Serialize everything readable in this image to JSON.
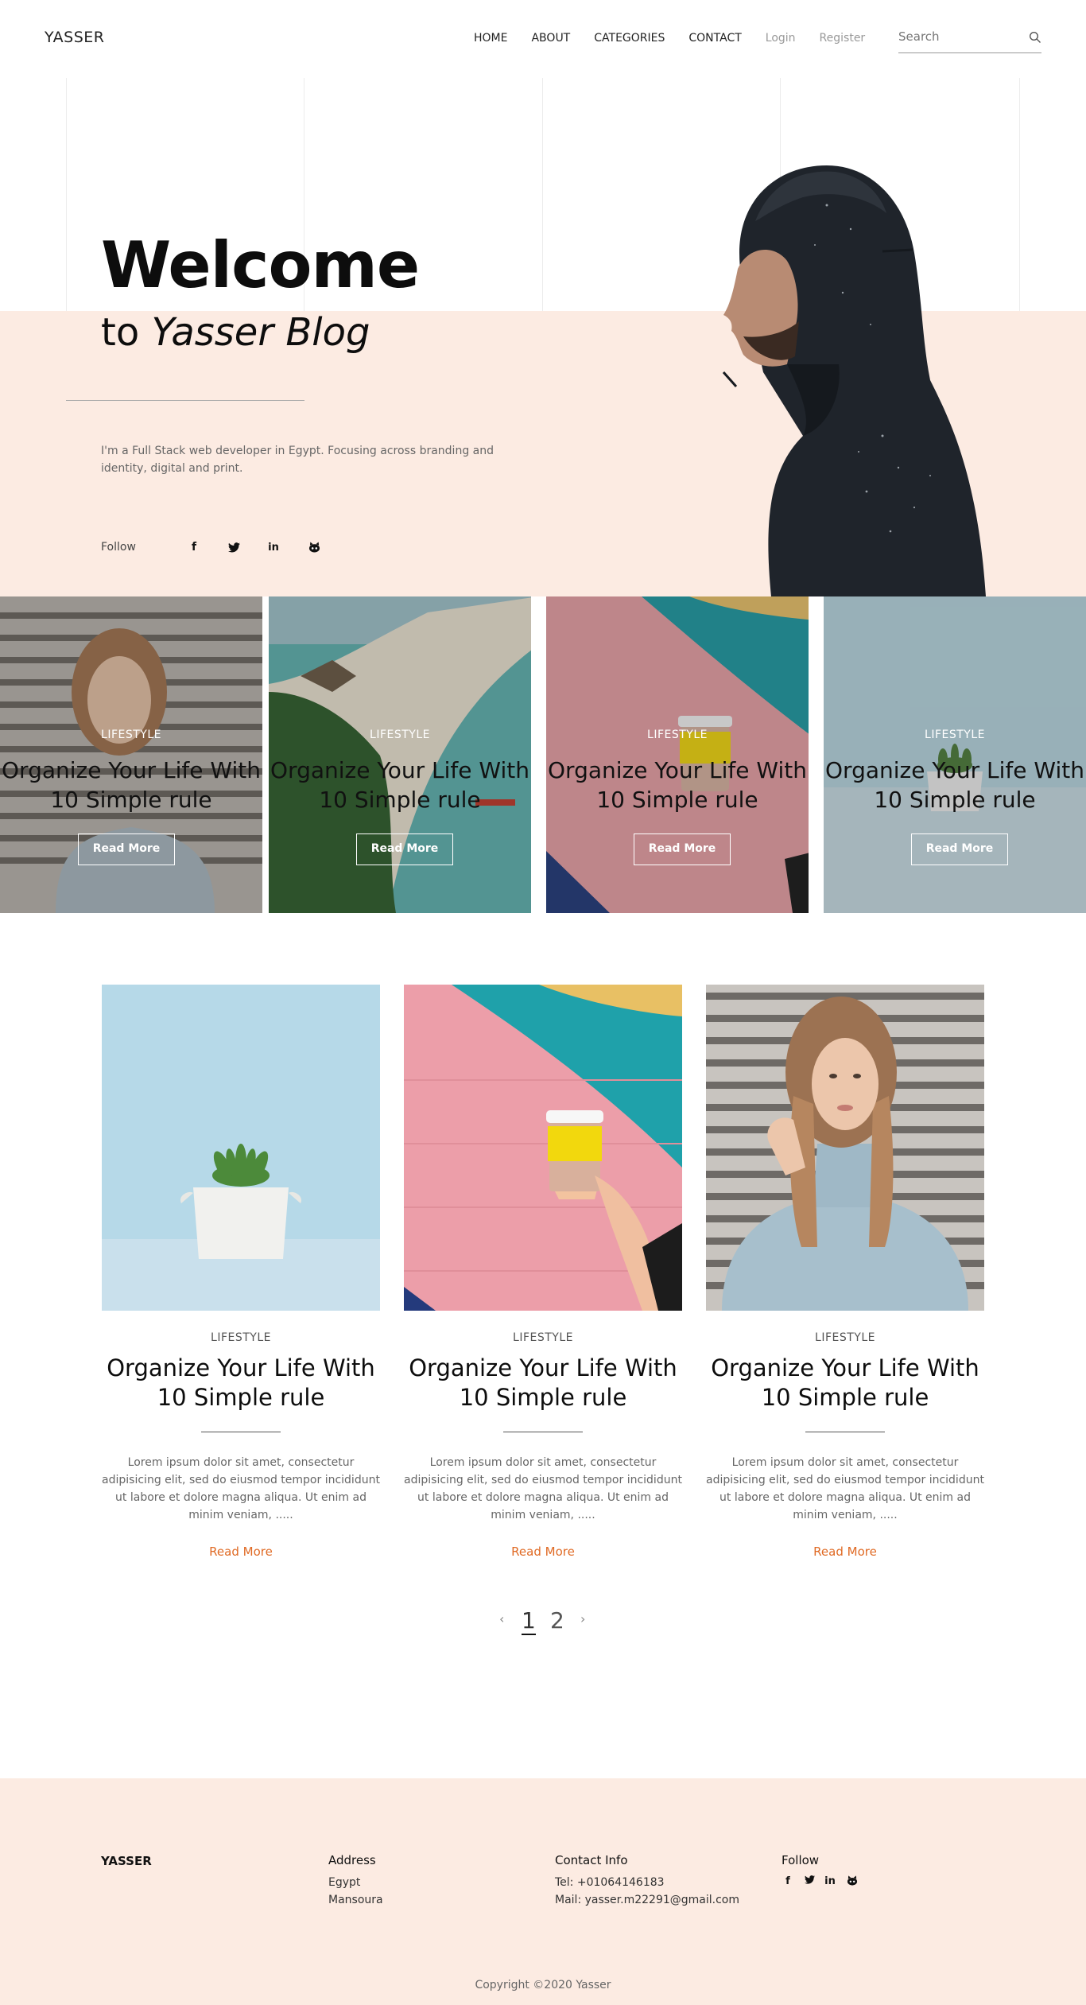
{
  "nav": {
    "brand": "YASSER",
    "items": [
      "HOME",
      "ABOUT",
      "CATEGORIES",
      "CONTACT"
    ],
    "login": "Login",
    "register": "Register",
    "search_placeholder": "Search"
  },
  "hero": {
    "title": "Welcome",
    "subtitle_prefix": "to",
    "subtitle_name": "Yasser Blog",
    "description": "I'm a Full Stack web developer in Egypt. Focusing across branding and identity, digital and print.",
    "follow_label": "Follow",
    "social": [
      "facebook-icon",
      "twitter-icon",
      "linkedin-icon",
      "github-icon"
    ],
    "band_color": "#fcebe2"
  },
  "featured": [
    {
      "category": "LIFESTYLE",
      "title": "Organize Your Life With 10 Simple rule",
      "button": "Read More",
      "image": "woman-portrait"
    },
    {
      "category": "LIFESTYLE",
      "title": "Organize Your Life With 10 Simple rule",
      "button": "Read More",
      "image": "tropical-island"
    },
    {
      "category": "LIFESTYLE",
      "title": "Organize Your Life With 10 Simple rule",
      "button": "Read More",
      "image": "coffee-cup-wall"
    },
    {
      "category": "LIFESTYLE",
      "title": "Organize Your Life With 10 Simple rule",
      "button": "Read More",
      "image": "plant-blue"
    }
  ],
  "posts": [
    {
      "category": "LIFESTYLE",
      "title": "Organize Your Life With 10 Simple rule",
      "excerpt": "Lorem ipsum dolor sit amet, consectetur adipisicing elit, sed do eiusmod tempor incididunt ut labore et dolore magna aliqua. Ut enim ad minim veniam, .....",
      "read_more": "Read More",
      "image": "plant-pot"
    },
    {
      "category": "LIFESTYLE",
      "title": "Organize Your Life With 10 Simple rule",
      "excerpt": "Lorem ipsum dolor sit amet, consectetur adipisicing elit, sed do eiusmod tempor incididunt ut labore et dolore magna aliqua. Ut enim ad minim veniam, .....",
      "read_more": "Read More",
      "image": "coffee-cup-wall"
    },
    {
      "category": "LIFESTYLE",
      "title": "Organize Your Life With 10 Simple rule",
      "excerpt": "Lorem ipsum dolor sit amet, consectetur adipisicing elit, sed do eiusmod tempor incididunt ut labore et dolore magna aliqua. Ut enim ad minim veniam, .....",
      "read_more": "Read More",
      "image": "woman-portrait"
    }
  ],
  "pagination": {
    "prev": "‹",
    "pages": [
      "1",
      "2"
    ],
    "current": "1",
    "next": "›"
  },
  "footer": {
    "brand": "YASSER",
    "address_heading": "Address",
    "address_lines": [
      "Egypt",
      "Mansoura"
    ],
    "contact_heading": "Contact Info",
    "contact_lines": [
      "Tel: +01064146183",
      "Mail: yasser.m22291@gmail.com"
    ],
    "follow_heading": "Follow",
    "copyright": "Copyright ©2020 Yasser"
  },
  "colors": {
    "accent": "#e06a24",
    "peach": "#fcebe2"
  }
}
